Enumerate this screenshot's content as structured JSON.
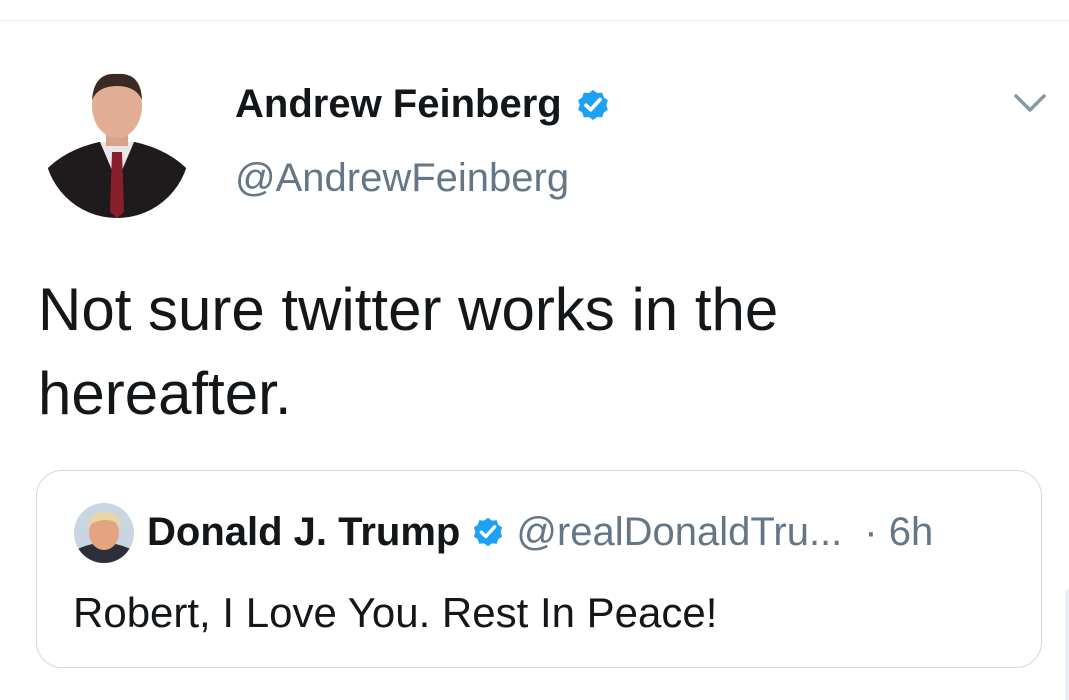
{
  "tweet": {
    "author": {
      "name": "Andrew Feinberg",
      "handle": "@AndrewFeinberg",
      "verified": true,
      "avatar_icon": "profile-photo"
    },
    "text": "Not sure twitter works in the hereafter.",
    "menu_icon": "chevron-down-icon"
  },
  "quoted": {
    "author": {
      "name": "Donald J. Trump",
      "handle": "@realDonaldTru...",
      "verified": true,
      "avatar_icon": "profile-photo"
    },
    "time": "· 6h",
    "text": "Robert, I Love You. Rest In Peace!"
  },
  "colors": {
    "verified_blue": "#1da1f2",
    "secondary_text": "#657786",
    "border": "#cfd9de"
  }
}
